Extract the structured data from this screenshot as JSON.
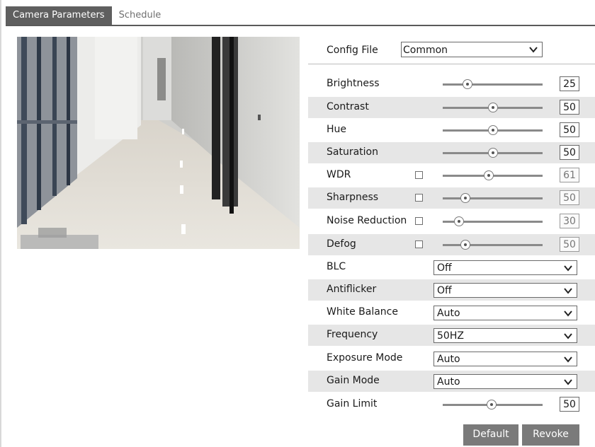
{
  "tabs": [
    {
      "label": "Camera Parameters",
      "active": true
    },
    {
      "label": "Schedule",
      "active": false
    }
  ],
  "config_file": {
    "label": "Config File",
    "value": "Common"
  },
  "controls": {
    "brightness": {
      "label": "Brightness",
      "value": "25",
      "level": 0.25,
      "enabled": true
    },
    "contrast": {
      "label": "Contrast",
      "value": "50",
      "level": 0.5,
      "enabled": true
    },
    "hue": {
      "label": "Hue",
      "value": "50",
      "level": 0.5,
      "enabled": true
    },
    "saturation": {
      "label": "Saturation",
      "value": "50",
      "level": 0.5,
      "enabled": true
    },
    "wdr": {
      "label": "WDR",
      "value": "61",
      "level": 0.46,
      "enabled": false
    },
    "sharpness": {
      "label": "Sharpness",
      "value": "50",
      "level": 0.23,
      "enabled": false
    },
    "noise_reduction": {
      "label": "Noise Reduction",
      "value": "30",
      "level": 0.16,
      "enabled": false
    },
    "defog": {
      "label": "Defog",
      "value": "50",
      "level": 0.23,
      "enabled": false
    },
    "gain_limit": {
      "label": "Gain Limit",
      "value": "50",
      "level": 0.49,
      "enabled": true
    }
  },
  "selects": {
    "blc": {
      "label": "BLC",
      "value": "Off"
    },
    "antiflicker": {
      "label": "Antiflicker",
      "value": "Off"
    },
    "white_balance": {
      "label": "White Balance",
      "value": "Auto"
    },
    "frequency": {
      "label": "Frequency",
      "value": "50HZ"
    },
    "exposure_mode": {
      "label": "Exposure Mode",
      "value": "Auto"
    },
    "gain_mode": {
      "label": "Gain Mode",
      "value": "Auto"
    }
  },
  "buttons": {
    "default": "Default",
    "revoke": "Revoke"
  },
  "colors": {
    "tab_active": "#5f5f5f",
    "row_alt": "#e6e6e6",
    "button": "#7a7a7a"
  }
}
